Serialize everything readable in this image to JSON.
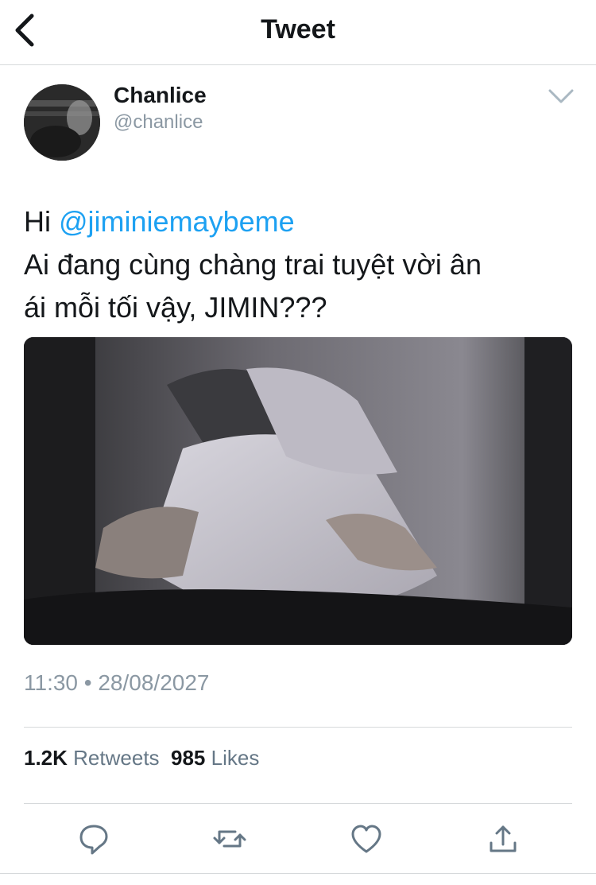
{
  "header": {
    "title": "Tweet",
    "back_icon": "chevron-left-icon"
  },
  "tweet": {
    "author_name": "Chanlice",
    "author_handle": "@chanlice",
    "text_greeting": "Hi ",
    "mention": "@jiminiemaybeme",
    "text_line2": "Ai đang cùng chàng trai tuyệt vời ân",
    "text_line3": "ái mỗi tối vậy, JIMIN???",
    "timestamp": "11:30 • 28/08/2027",
    "retweets_count": "1.2K",
    "retweets_label": "Retweets",
    "likes_count": "985",
    "likes_label": "Likes"
  },
  "actions": {
    "reply_icon": "reply-icon",
    "retweet_icon": "retweet-icon",
    "like_icon": "heart-icon",
    "share_icon": "share-icon"
  },
  "colors": {
    "accent": "#1da1f2",
    "muted": "#8b98a3",
    "text": "#14171a"
  }
}
